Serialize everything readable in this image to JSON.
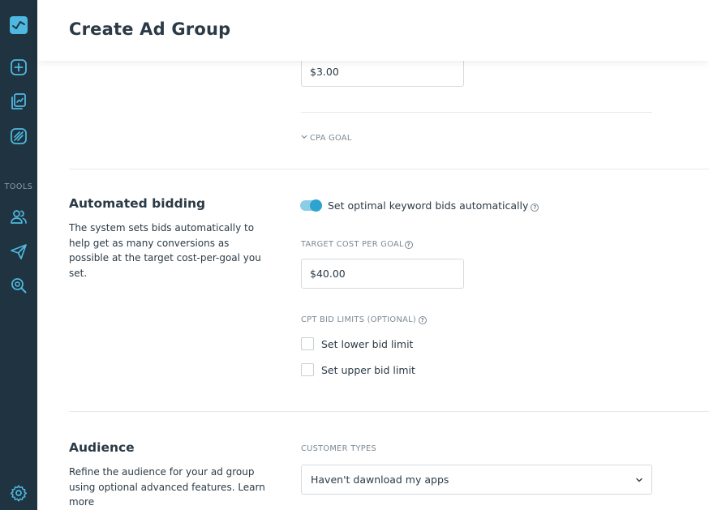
{
  "page": {
    "title": "Create Ad Group"
  },
  "sidebar": {
    "tools_label": "TOOLS",
    "items": [
      {
        "icon": "dashboard-logo-icon"
      },
      {
        "icon": "add-square-icon"
      },
      {
        "icon": "reports-icon"
      },
      {
        "icon": "campaign-icon"
      },
      {
        "icon": "audience-users-icon"
      },
      {
        "icon": "send-paper-plane-icon"
      },
      {
        "icon": "search-insights-icon"
      },
      {
        "icon": "settings-gear-icon"
      }
    ],
    "colors": {
      "background": "#1f3440",
      "icon": "#4fb8e0",
      "logo_bg": "#4fb8e0"
    }
  },
  "bidding": {
    "max_cpt_value": "$3.00",
    "cpa_goal_link": "CPA GOAL"
  },
  "automated_bidding": {
    "title": "Automated bidding",
    "description": "The system sets bids automatically to help get as many conversions as possible at the target cost-per-goal you set.",
    "toggle_label": "Set optimal keyword bids automatically",
    "toggle_on": true,
    "target_cost_label": "TARGET COST PER GOAL",
    "target_cost_value": "$40.00",
    "bid_limits_label": "CPT BID LIMITS (OPTIONAL)",
    "lower_limit_label": "Set lower bid limit",
    "upper_limit_label": "Set upper bid limit"
  },
  "audience": {
    "title": "Audience",
    "description": "Refine the audience for your ad group using optional advanced features.  Learn more",
    "customer_types_label": "CUSTOMER TYPES",
    "customer_types_value": "Haven't dawnload my apps"
  },
  "accent_color": "#2ea3cf"
}
